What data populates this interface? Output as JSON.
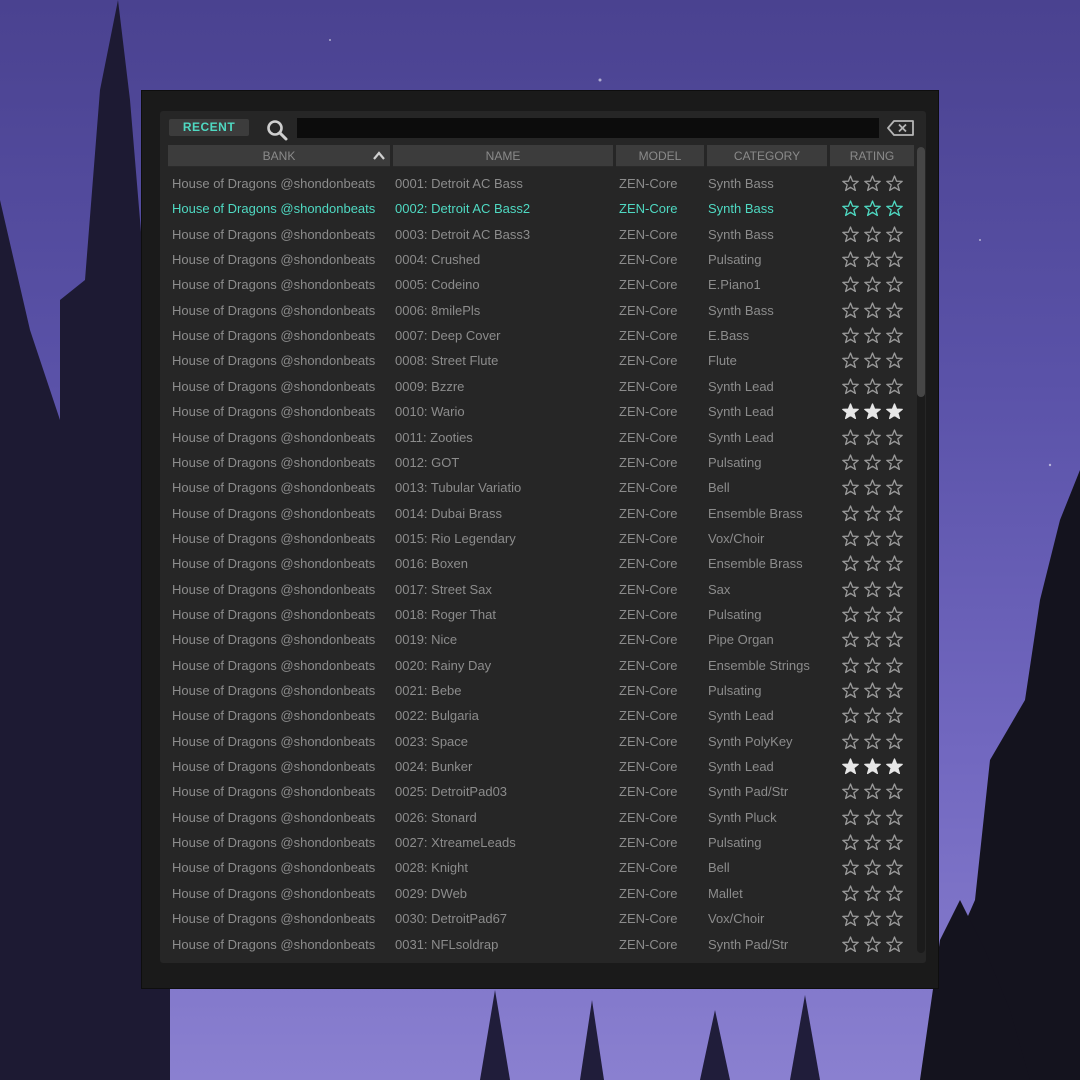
{
  "toolbar": {
    "recent_label": "RECENT",
    "search_value": "",
    "search_placeholder": ""
  },
  "table": {
    "columns": [
      "BANK",
      "NAME",
      "MODEL",
      "CATEGORY",
      "RATING"
    ],
    "sort_column": "BANK",
    "sort_direction": "ascending",
    "selected_index": 1,
    "rows": [
      {
        "bank": "House of Dragons @shondonbeats",
        "name": "0001: Detroit AC Bass",
        "model": "ZEN-Core",
        "category": "Synth Bass",
        "rating": 0
      },
      {
        "bank": "House of Dragons @shondonbeats",
        "name": "0002: Detroit AC Bass2",
        "model": "ZEN-Core",
        "category": "Synth Bass",
        "rating": 0
      },
      {
        "bank": "House of Dragons @shondonbeats",
        "name": "0003: Detroit AC Bass3",
        "model": "ZEN-Core",
        "category": "Synth Bass",
        "rating": 0
      },
      {
        "bank": "House of Dragons @shondonbeats",
        "name": "0004: Crushed",
        "model": "ZEN-Core",
        "category": "Pulsating",
        "rating": 0
      },
      {
        "bank": "House of Dragons @shondonbeats",
        "name": "0005: Codeino",
        "model": "ZEN-Core",
        "category": "E.Piano1",
        "rating": 0
      },
      {
        "bank": "House of Dragons @shondonbeats",
        "name": "0006: 8milePls",
        "model": "ZEN-Core",
        "category": "Synth Bass",
        "rating": 0
      },
      {
        "bank": "House of Dragons @shondonbeats",
        "name": "0007: Deep Cover",
        "model": "ZEN-Core",
        "category": "E.Bass",
        "rating": 0
      },
      {
        "bank": "House of Dragons @shondonbeats",
        "name": "0008: Street Flute",
        "model": "ZEN-Core",
        "category": "Flute",
        "rating": 0
      },
      {
        "bank": "House of Dragons @shondonbeats",
        "name": "0009: Bzzre",
        "model": "ZEN-Core",
        "category": "Synth Lead",
        "rating": 0
      },
      {
        "bank": "House of Dragons @shondonbeats",
        "name": "0010: Wario",
        "model": "ZEN-Core",
        "category": "Synth Lead",
        "rating": 3
      },
      {
        "bank": "House of Dragons @shondonbeats",
        "name": "0011: Zooties",
        "model": "ZEN-Core",
        "category": "Synth Lead",
        "rating": 0
      },
      {
        "bank": "House of Dragons @shondonbeats",
        "name": "0012: GOT",
        "model": "ZEN-Core",
        "category": "Pulsating",
        "rating": 0
      },
      {
        "bank": "House of Dragons @shondonbeats",
        "name": "0013: Tubular Variatio",
        "model": "ZEN-Core",
        "category": "Bell",
        "rating": 0
      },
      {
        "bank": "House of Dragons @shondonbeats",
        "name": "0014: Dubai Brass",
        "model": "ZEN-Core",
        "category": "Ensemble Brass",
        "rating": 0
      },
      {
        "bank": "House of Dragons @shondonbeats",
        "name": "0015: Rio Legendary",
        "model": "ZEN-Core",
        "category": "Vox/Choir",
        "rating": 0
      },
      {
        "bank": "House of Dragons @shondonbeats",
        "name": "0016: Boxen",
        "model": "ZEN-Core",
        "category": "Ensemble Brass",
        "rating": 0
      },
      {
        "bank": "House of Dragons @shondonbeats",
        "name": "0017: Street Sax",
        "model": "ZEN-Core",
        "category": "Sax",
        "rating": 0
      },
      {
        "bank": "House of Dragons @shondonbeats",
        "name": "0018: Roger That",
        "model": "ZEN-Core",
        "category": "Pulsating",
        "rating": 0
      },
      {
        "bank": "House of Dragons @shondonbeats",
        "name": "0019: Nice",
        "model": "ZEN-Core",
        "category": "Pipe Organ",
        "rating": 0
      },
      {
        "bank": "House of Dragons @shondonbeats",
        "name": "0020: Rainy Day",
        "model": "ZEN-Core",
        "category": "Ensemble Strings",
        "rating": 0
      },
      {
        "bank": "House of Dragons @shondonbeats",
        "name": "0021: Bebe",
        "model": "ZEN-Core",
        "category": "Pulsating",
        "rating": 0
      },
      {
        "bank": "House of Dragons @shondonbeats",
        "name": "0022: Bulgaria",
        "model": "ZEN-Core",
        "category": "Synth Lead",
        "rating": 0
      },
      {
        "bank": "House of Dragons @shondonbeats",
        "name": "0023: Space",
        "model": "ZEN-Core",
        "category": "Synth PolyKey",
        "rating": 0
      },
      {
        "bank": "House of Dragons @shondonbeats",
        "name": "0024: Bunker",
        "model": "ZEN-Core",
        "category": "Synth Lead",
        "rating": 3
      },
      {
        "bank": "House of Dragons @shondonbeats",
        "name": "0025: DetroitPad03",
        "model": "ZEN-Core",
        "category": "Synth Pad/Str",
        "rating": 0
      },
      {
        "bank": "House of Dragons @shondonbeats",
        "name": "0026: Stonard",
        "model": "ZEN-Core",
        "category": "Synth Pluck",
        "rating": 0
      },
      {
        "bank": "House of Dragons @shondonbeats",
        "name": "0027: XtreameLeads",
        "model": "ZEN-Core",
        "category": "Pulsating",
        "rating": 0
      },
      {
        "bank": "House of Dragons @shondonbeats",
        "name": "0028: Knight",
        "model": "ZEN-Core",
        "category": "Bell",
        "rating": 0
      },
      {
        "bank": "House of Dragons @shondonbeats",
        "name": "0029: DWeb",
        "model": "ZEN-Core",
        "category": "Mallet",
        "rating": 0
      },
      {
        "bank": "House of Dragons @shondonbeats",
        "name": "0030: DetroitPad67",
        "model": "ZEN-Core",
        "category": "Vox/Choir",
        "rating": 0
      },
      {
        "bank": "House of Dragons @shondonbeats",
        "name": "0031: NFLsoldrap",
        "model": "ZEN-Core",
        "category": "Synth Pad/Str",
        "rating": 0
      }
    ]
  },
  "scroll": {
    "position_fraction": 0.0,
    "visible_fraction": 0.31
  },
  "colors": {
    "accent": "#4fd9c2",
    "text": "#8c8c8c",
    "row_bg": "#262626",
    "header_bg": "#3c3c3c",
    "star_empty": "#9a9a9a",
    "star_filled": "#e6e6e6"
  },
  "icons": {
    "search": "search-icon",
    "clear": "backspace-icon",
    "sort": "chevron-up-icon",
    "rating": "star-icon"
  }
}
